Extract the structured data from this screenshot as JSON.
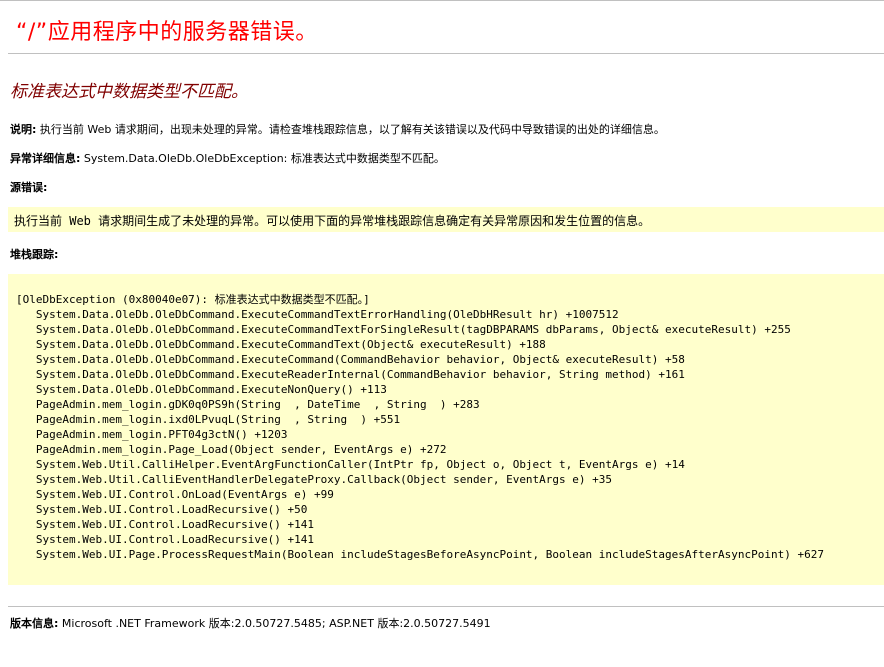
{
  "page": {
    "title": "“/”应用程序中的服务器错误。",
    "error_message": "标准表达式中数据类型不匹配。"
  },
  "description": {
    "label": "说明:",
    "text": "执行当前 Web 请求期间，出现未处理的异常。请检查堆栈跟踪信息，以了解有关该错误以及代码中导致错误的出处的详细信息。"
  },
  "exception_details": {
    "label": "异常详细信息:",
    "text": "System.Data.OleDb.OleDbException: 标准表达式中数据类型不匹配。"
  },
  "source_error": {
    "label": "源错误:",
    "text": "执行当前 Web 请求期间生成了未处理的异常。可以使用下面的异常堆栈跟踪信息确定有关异常原因和发生位置的信息。"
  },
  "stack_trace": {
    "label": "堆栈跟踪:",
    "lines": [
      "[OleDbException (0x80040e07): 标准表达式中数据类型不匹配。]",
      "   System.Data.OleDb.OleDbCommand.ExecuteCommandTextErrorHandling(OleDbHResult hr) +1007512",
      "   System.Data.OleDb.OleDbCommand.ExecuteCommandTextForSingleResult(tagDBPARAMS dbParams, Object& executeResult) +255",
      "   System.Data.OleDb.OleDbCommand.ExecuteCommandText(Object& executeResult) +188",
      "   System.Data.OleDb.OleDbCommand.ExecuteCommand(CommandBehavior behavior, Object& executeResult) +58",
      "   System.Data.OleDb.OleDbCommand.ExecuteReaderInternal(CommandBehavior behavior, String method) +161",
      "   System.Data.OleDb.OleDbCommand.ExecuteNonQuery() +113",
      "   PageAdmin.mem_login.gDK0q0PS9h(String  , DateTime  , String  ) +283",
      "   PageAdmin.mem_login.ixd0LPvuqL(String  , String  ) +551",
      "   PageAdmin.mem_login.PFT04g3ctN() +1203",
      "   PageAdmin.mem_login.Page_Load(Object sender, EventArgs e) +272",
      "   System.Web.Util.CalliHelper.EventArgFunctionCaller(IntPtr fp, Object o, Object t, EventArgs e) +14",
      "   System.Web.Util.CalliEventHandlerDelegateProxy.Callback(Object sender, EventArgs e) +35",
      "   System.Web.UI.Control.OnLoad(EventArgs e) +99",
      "   System.Web.UI.Control.LoadRecursive() +50",
      "   System.Web.UI.Control.LoadRecursive() +141",
      "   System.Web.UI.Control.LoadRecursive() +141",
      "   System.Web.UI.Page.ProcessRequestMain(Boolean includeStagesBeforeAsyncPoint, Boolean includeStagesAfterAsyncPoint) +627"
    ]
  },
  "version": {
    "label": "版本信息:",
    "text": "Microsoft .NET Framework 版本:2.0.50727.5485; ASP.NET 版本:2.0.50727.5491"
  }
}
